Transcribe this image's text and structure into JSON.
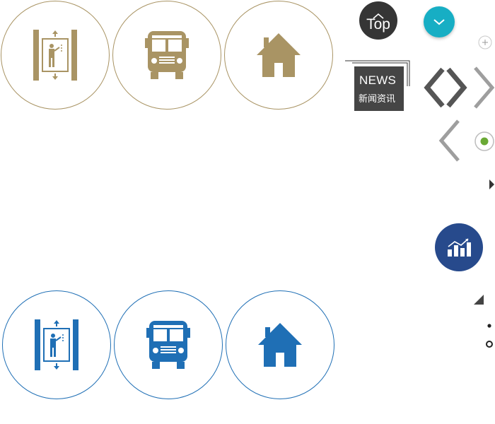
{
  "back_to_top": {
    "label": "Top",
    "icon": "chevron-up-icon"
  },
  "scroll_down": {
    "icon": "chevron-down-icon",
    "color": "#17aec4"
  },
  "news_badge": {
    "title": "NEWS",
    "subtitle": "新闻资讯"
  },
  "colors": {
    "gold": "#a99464",
    "blue": "#1f6fb5",
    "dark": "#353535",
    "teal": "#17aec4",
    "navy": "#274a8c",
    "green_dot": "#6aa935"
  },
  "gold_icons": [
    {
      "name": "elevator-icon"
    },
    {
      "name": "bus-icon"
    },
    {
      "name": "home-icon"
    }
  ],
  "blue_icons": [
    {
      "name": "elevator-icon"
    },
    {
      "name": "bus-icon"
    },
    {
      "name": "home-icon"
    }
  ],
  "controls": [
    {
      "name": "prev-next-arrows-icon"
    },
    {
      "name": "chevron-right-icon"
    },
    {
      "name": "chevron-left-icon"
    },
    {
      "name": "plus-icon"
    },
    {
      "name": "radio-selected-icon"
    },
    {
      "name": "caret-right-icon"
    },
    {
      "name": "bar-chart-icon"
    },
    {
      "name": "resize-corner-icon"
    },
    {
      "name": "dot-bullet-icon"
    },
    {
      "name": "ring-bullet-icon"
    }
  ]
}
